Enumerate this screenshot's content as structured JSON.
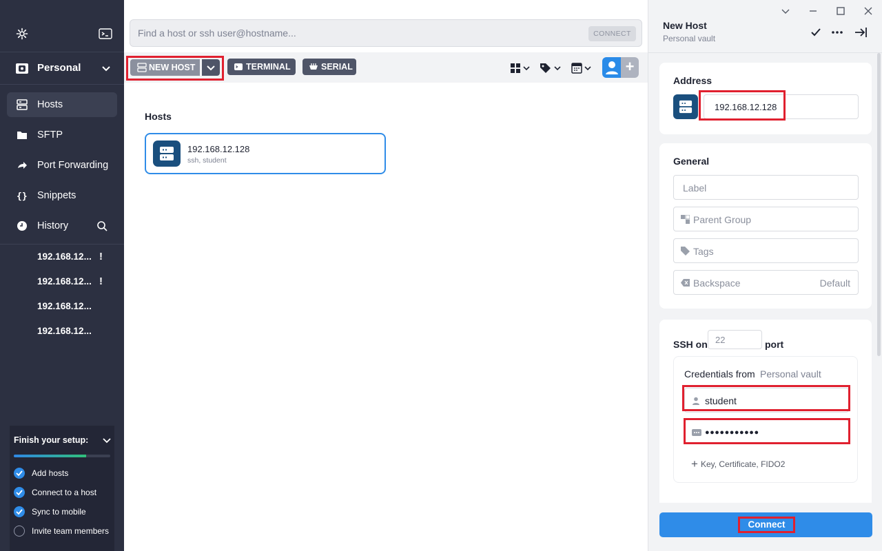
{
  "sidebar": {
    "vault_label": "Personal",
    "nav": [
      {
        "label": "Hosts"
      },
      {
        "label": "SFTP"
      },
      {
        "label": "Port Forwarding"
      },
      {
        "label": "Snippets"
      },
      {
        "label": "History"
      }
    ],
    "history": [
      {
        "label": "192.168.12...",
        "warning": "!"
      },
      {
        "label": "192.168.12...",
        "warning": "!"
      },
      {
        "label": "192.168.12...",
        "warning": ""
      },
      {
        "label": "192.168.12...",
        "warning": ""
      }
    ],
    "setup": {
      "title": "Finish your setup:",
      "progress": 0.75,
      "steps": [
        {
          "label": "Add hosts",
          "done": true
        },
        {
          "label": "Connect to a host",
          "done": true
        },
        {
          "label": "Sync to mobile",
          "done": true
        },
        {
          "label": "Invite team members",
          "done": false
        }
      ]
    }
  },
  "main": {
    "search_placeholder": "Find a host or ssh user@hostname...",
    "connect_label": "CONNECT",
    "new_host_label": "NEW HOST",
    "terminal_label": "TERMINAL",
    "serial_label": "SERIAL",
    "section_title": "Hosts",
    "hosts": [
      {
        "name": "192.168.12.128",
        "sub": "ssh, student"
      }
    ]
  },
  "panel": {
    "title": "New Host",
    "subtitle": "Personal vault",
    "address_title": "Address",
    "address_value": "192.168.12.128",
    "general_title": "General",
    "label_placeholder": "Label",
    "parent_group_placeholder": "Parent Group",
    "tags_placeholder": "Tags",
    "backspace_label": "Backspace",
    "backspace_value": "Default",
    "ssh_label": "SSH on",
    "port_value": "22",
    "port_label": "port",
    "credentials_label": "Credentials from",
    "credentials_vault": "Personal vault",
    "username": "student",
    "password_mask": "●●●●●●●●●●●",
    "key_link": "Key, Certificate, FIDO2",
    "connect_button": "Connect"
  },
  "colors": {
    "sidebar_bg": "#2c3041",
    "accent": "#2f8ce8",
    "highlight": "#e0202f",
    "host_icon_bg": "#1a4f7e"
  }
}
